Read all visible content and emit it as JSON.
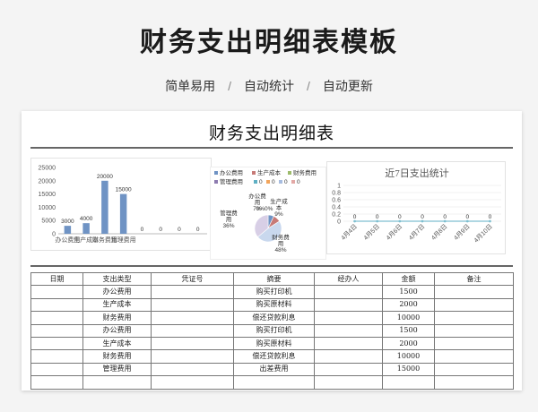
{
  "hero": {
    "title": "财务支出明细表模板",
    "tags": [
      "简单易用",
      "自动统计",
      "自动更新"
    ],
    "separator": "/"
  },
  "sheet": {
    "title": "财务支出明细表"
  },
  "chart_data": [
    {
      "type": "bar",
      "categories": [
        "办公费用",
        "生产成本",
        "财务费用",
        "管理费用",
        "",
        "",
        "",
        ""
      ],
      "values": [
        3000,
        4000,
        20000,
        15000,
        0,
        0,
        0,
        0
      ],
      "data_labels": [
        "3000",
        "4000",
        "20000",
        "15000",
        "0",
        "0",
        "0",
        "0"
      ],
      "ytick_labels": [
        "0",
        "5000",
        "10000",
        "15000",
        "20000",
        "25000"
      ],
      "ylim": [
        0,
        25000
      ],
      "bar_color": "#6f93c4"
    },
    {
      "type": "pie",
      "legend": [
        "办公费用",
        "生产成本",
        "财务费用",
        "管理费用",
        "0",
        "0",
        "0",
        "0"
      ],
      "legend_colors": [
        "#6f93c4",
        "#c77a77",
        "#9dbb6b",
        "#8d7bb0",
        "#5fb0c4",
        "#f2a55c",
        "#a8bde0",
        "#e3a9a6"
      ],
      "labels": [
        "办公费用 7%",
        "生产成本 9%",
        "财务费用 48%",
        "管理费用 36%"
      ],
      "values": [
        7,
        9,
        48,
        36
      ],
      "colors": [
        "#6f93c4",
        "#c77a77",
        "#c9d8ee",
        "#d8cfe6"
      ],
      "slice_labels": {
        "office": [
          "办公费",
          "用",
          "7%"
        ],
        "production": [
          "生产成",
          "本",
          "9%"
        ],
        "finance": [
          "财务费",
          "用",
          "48%"
        ],
        "management": [
          "管理费",
          "用",
          "36%"
        ],
        "zeros": "0%0%"
      }
    },
    {
      "type": "line",
      "title": "近7日支出统计",
      "categories": [
        "4月4日",
        "4月5日",
        "4月6日",
        "4月7日",
        "4月8日",
        "4月9日",
        "4月10日"
      ],
      "values": [
        0,
        0,
        0,
        0,
        0,
        0,
        0
      ],
      "data_labels": [
        "0",
        "0",
        "0",
        "0",
        "0",
        "0",
        "0"
      ],
      "ytick_labels": [
        "0",
        "0.2",
        "0.4",
        "0.6",
        "0.8",
        "1"
      ],
      "ylim": [
        0,
        1
      ],
      "line_color": "#7fbfd0"
    }
  ],
  "table": {
    "headers": [
      "日期",
      "支出类型",
      "凭证号",
      "摘要",
      "经办人",
      "金额",
      "备注"
    ],
    "rows": [
      [
        "",
        "办公费用",
        "",
        "购买打印机",
        "",
        "1500",
        ""
      ],
      [
        "",
        "生产成本",
        "",
        "购买原材料",
        "",
        "2000",
        ""
      ],
      [
        "",
        "财务费用",
        "",
        "偿还贷款利息",
        "",
        "10000",
        ""
      ],
      [
        "",
        "办公费用",
        "",
        "购买打印机",
        "",
        "1500",
        ""
      ],
      [
        "",
        "生产成本",
        "",
        "购买原材料",
        "",
        "2000",
        ""
      ],
      [
        "",
        "财务费用",
        "",
        "偿还贷款利息",
        "",
        "10000",
        ""
      ],
      [
        "",
        "管理费用",
        "",
        "出差费用",
        "",
        "15000",
        ""
      ],
      [
        "",
        "",
        "",
        "",
        "",
        "",
        ""
      ]
    ]
  }
}
